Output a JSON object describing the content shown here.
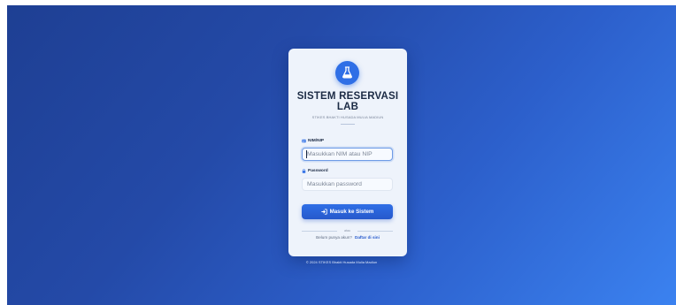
{
  "header": {
    "title": "SISTEM RESERVASI LAB",
    "subtitle": "STIKES BHAKTI HUSADA MULIA MADIUN",
    "logo_icon": "flask-icon"
  },
  "form": {
    "nim_label": "NIM/NIP",
    "nim_placeholder": "Masukkan NIM atau NIP",
    "nim_value": "",
    "password_label": "Password",
    "password_placeholder": "Masukkan password",
    "password_value": "",
    "submit_label": "Masuk ke Sistem"
  },
  "divider": {
    "text": "atau"
  },
  "register": {
    "prompt": "Belum punya akun?",
    "link_label": "Daftar di sini"
  },
  "footer": {
    "text": "© 2024 STIKES Bhakti Husada Mulia Madiun"
  },
  "colors": {
    "accent": "#2f6fe6",
    "background_start": "#1e3f93",
    "background_end": "#3b82f0",
    "card": "#eef3fb"
  }
}
